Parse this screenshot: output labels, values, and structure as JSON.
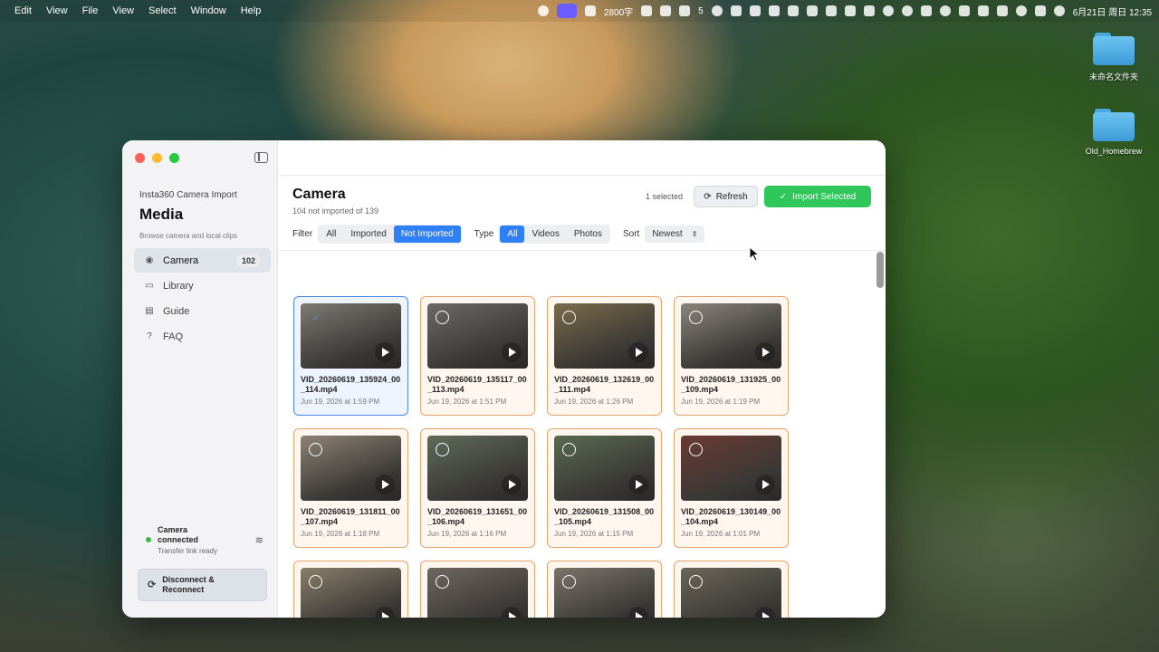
{
  "menubar": {
    "items": [
      "Edit",
      "View",
      "File",
      "View",
      "Select",
      "Window",
      "Help"
    ],
    "word_count": "2800字",
    "badge_count": "5",
    "datetime": "6月21日 周日 12:35"
  },
  "desktop": {
    "items": [
      {
        "label": "未命名文件夹"
      },
      {
        "label": "Old_Homebrew"
      }
    ]
  },
  "sidebar": {
    "app_sub": "Insta360 Camera Import",
    "title": "Media",
    "caption": "Browse camera and local clips",
    "items": [
      {
        "label": "Camera",
        "icon": "record-icon",
        "badge": "102",
        "active": true
      },
      {
        "label": "Library",
        "icon": "folder-icon"
      },
      {
        "label": "Guide",
        "icon": "book-icon"
      },
      {
        "label": "FAQ",
        "icon": "question-icon"
      }
    ],
    "status_title": "Camera connected",
    "status_sub": "Transfer link ready",
    "disconnect_label": "Disconnect & Reconnect"
  },
  "main": {
    "title": "Camera",
    "subtitle": "104 not imported of 139",
    "selected_count": "1 selected",
    "refresh_label": "Refresh",
    "import_label": "Import Selected",
    "filter_label": "Filter",
    "filter_options": [
      "All",
      "Imported",
      "Not Imported"
    ],
    "filter_selected": "Not Imported",
    "type_label": "Type",
    "type_options": [
      "All",
      "Videos",
      "Photos"
    ],
    "type_selected": "All",
    "sort_label": "Sort",
    "sort_value": "Newest"
  },
  "clips": [
    {
      "name": "VID_20260619_135924_00_114.mp4",
      "date": "Jun 19, 2026 at 1:59 PM",
      "selected": true,
      "color": "#7d7a74"
    },
    {
      "name": "VID_20260619_135117_00_113.mp4",
      "date": "Jun 19, 2026 at 1:51 PM",
      "selected": false,
      "color": "#6c6a68"
    },
    {
      "name": "VID_20260619_132619_00_111.mp4",
      "date": "Jun 19, 2026 at 1:26 PM",
      "selected": false,
      "color": "#7a6b4a"
    },
    {
      "name": "VID_20260619_131925_00_109.mp4",
      "date": "Jun 19, 2026 at 1:19 PM",
      "selected": false,
      "color": "#8a857c"
    },
    {
      "name": "VID_20260619_131811_00_107.mp4",
      "date": "Jun 19, 2026 at 1:18 PM",
      "selected": false,
      "color": "#8d8274"
    },
    {
      "name": "VID_20260619_131651_00_106.mp4",
      "date": "Jun 19, 2026 at 1:16 PM",
      "selected": false,
      "color": "#5f6a5a"
    },
    {
      "name": "VID_20260619_131508_00_105.mp4",
      "date": "Jun 19, 2026 at 1:15 PM",
      "selected": false,
      "color": "#5a6a52"
    },
    {
      "name": "VID_20260619_130149_00_104.mp4",
      "date": "Jun 19, 2026 at 1:01 PM",
      "selected": false,
      "color": "#6a3a32"
    },
    {
      "name": "",
      "date": "",
      "selected": false,
      "color": "#8a7e6a"
    },
    {
      "name": "",
      "date": "",
      "selected": false,
      "color": "#6e6660"
    },
    {
      "name": "",
      "date": "",
      "selected": false,
      "color": "#7a746a"
    },
    {
      "name": "",
      "date": "",
      "selected": false,
      "color": "#6a6658"
    }
  ]
}
